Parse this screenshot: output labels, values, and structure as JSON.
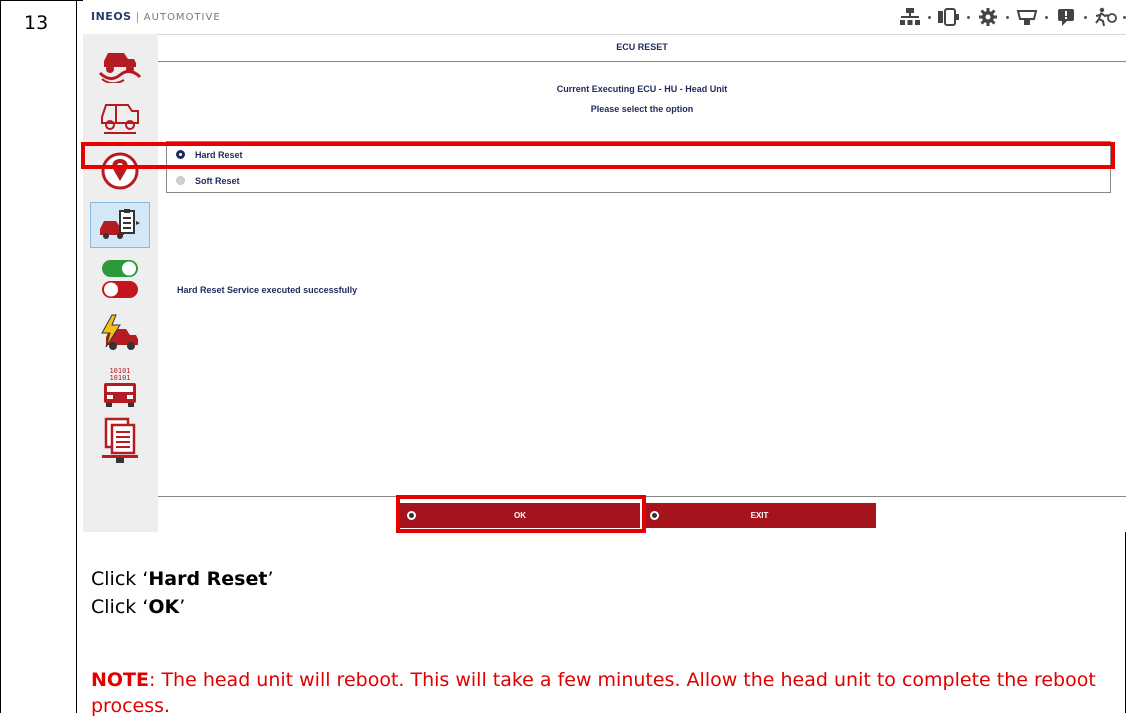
{
  "step_number": "13",
  "app": {
    "logo_brand": "INEOS",
    "logo_suffix": "AUTOMOTIVE",
    "top_icons": [
      "network-icon",
      "battery-icon",
      "settings-gear-icon",
      "vci-device-icon",
      "notification-icon",
      "run-icon"
    ],
    "sidebar_icons": [
      "offroad-vehicle-icon",
      "vehicle-diagram-icon",
      "location-pin-icon",
      "vehicle-checklist-icon",
      "toggle-switches-icon",
      "electric-vehicle-icon",
      "ecu-binary-vehicle-icon",
      "document-report-icon"
    ],
    "header_title": "ECU RESET",
    "current_ecu": "Current Executing ECU - HU - Head Unit",
    "prompt": "Please select the option",
    "options": [
      {
        "label": "Hard Reset",
        "selected": true
      },
      {
        "label": "Soft Reset",
        "selected": false
      }
    ],
    "status_message": "Hard Reset Service executed successfully",
    "buttons": {
      "ok": "OK",
      "exit": "EXIT"
    },
    "colors": {
      "button": "#a5141c",
      "highlight": "#e60000",
      "text": "#1f2a5a"
    }
  },
  "instructions": {
    "line1_prefix": "Click ‘",
    "line1_bold": "Hard Reset",
    "line1_suffix": "’",
    "line2_prefix": "Click ‘",
    "line2_bold": "OK",
    "line2_suffix": "’",
    "note_label": "NOTE",
    "note_text": ": The head unit will reboot. This will take a few minutes. Allow the head unit to complete the reboot process."
  }
}
